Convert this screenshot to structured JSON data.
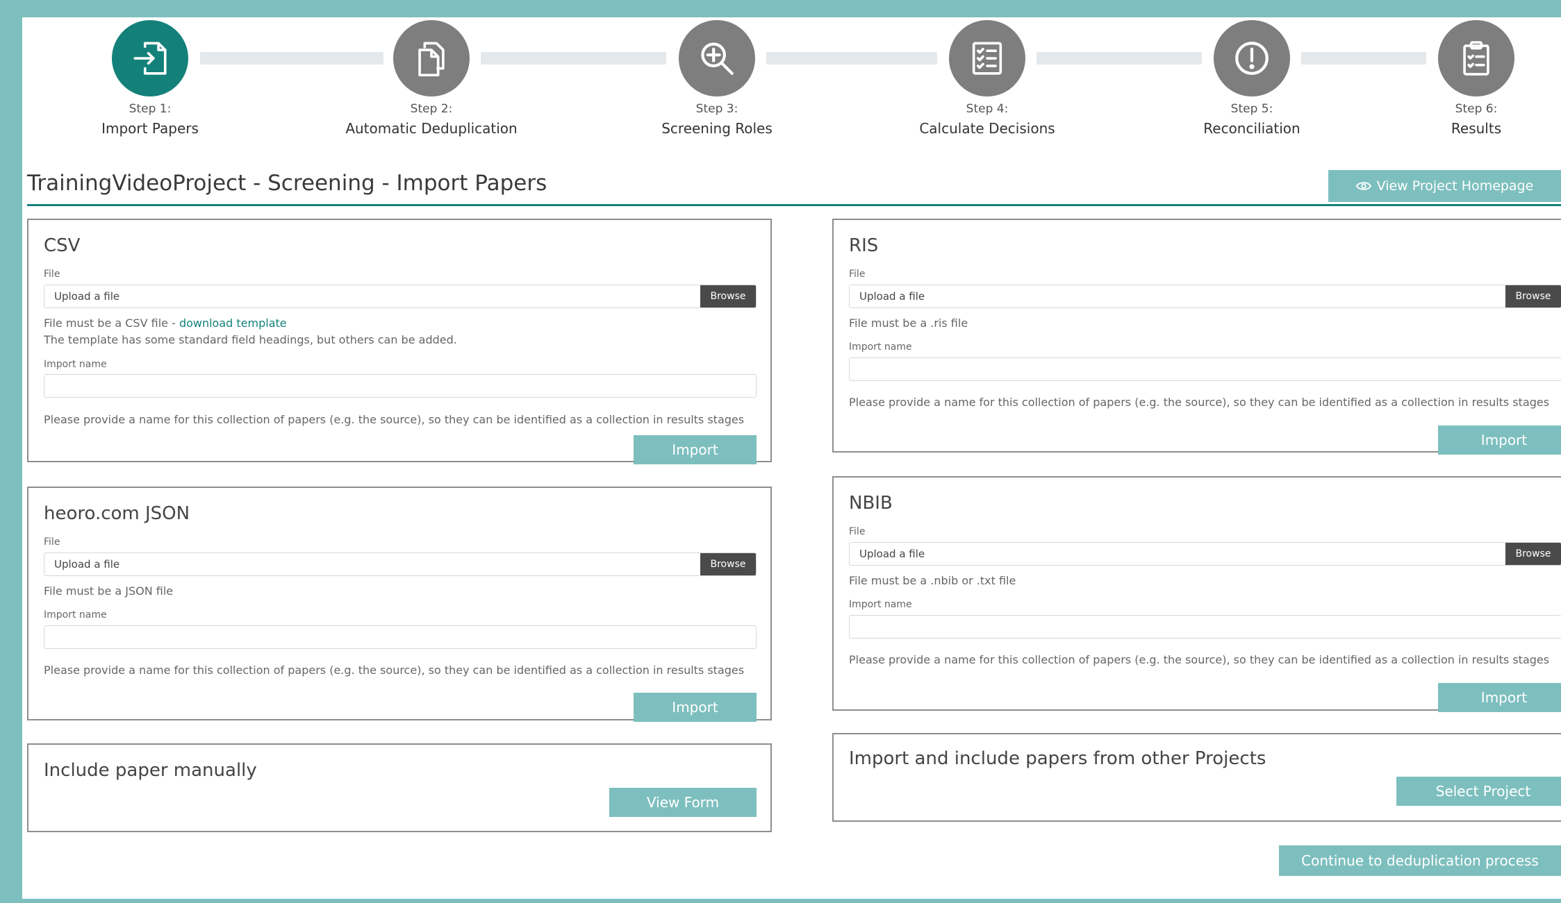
{
  "steps": [
    {
      "number": "Step 1:",
      "name": "Import Papers",
      "icon": "import-file-icon",
      "active": true
    },
    {
      "number": "Step 2:",
      "name": "Automatic Deduplication",
      "icon": "copy-documents-icon",
      "active": false
    },
    {
      "number": "Step 3:",
      "name": "Screening Roles",
      "icon": "magnify-plus-icon",
      "active": false
    },
    {
      "number": "Step 4:",
      "name": "Calculate Decisions",
      "icon": "checklist-icon",
      "active": false
    },
    {
      "number": "Step 5:",
      "name": "Reconciliation",
      "icon": "exclamation-circle-icon",
      "active": false
    },
    {
      "number": "Step 6:",
      "name": "Results",
      "icon": "clipboard-check-icon",
      "active": false
    }
  ],
  "header": {
    "title": "TrainingVideoProject - Screening - Import Papers",
    "view_homepage_label": "View Project Homepage",
    "view_homepage_icon": "eye-icon"
  },
  "common": {
    "file_label": "File",
    "upload_placeholder": "Upload a file",
    "browse_label": "Browse",
    "import_name_label": "Import name",
    "import_name_help": "Please provide a name for this collection of papers (e.g. the source), so they can be identified as a collection in results stages",
    "import_button": "Import"
  },
  "csv": {
    "title": "CSV",
    "help_prefix": "File must be a CSV file - ",
    "help_link": "download template",
    "help_line2": "The template has some standard field headings, but others can be added."
  },
  "ris": {
    "title": "RIS",
    "help": "File must be a .ris file"
  },
  "json": {
    "title": "heoro.com JSON",
    "help": "File must be a JSON file"
  },
  "nbib": {
    "title": "NBIB",
    "help": "File must be a .nbib or .txt file"
  },
  "manual": {
    "title": "Include paper manually",
    "button": "View Form"
  },
  "other_projects": {
    "title": "Import and include papers from other Projects",
    "button": "Select Project"
  },
  "continue_label": "Continue to deduplication process",
  "colors": {
    "primary": "#13817a",
    "button": "#7dbfbe",
    "inactive_step": "#7e7e7e",
    "browse": "#4a4a4a"
  }
}
